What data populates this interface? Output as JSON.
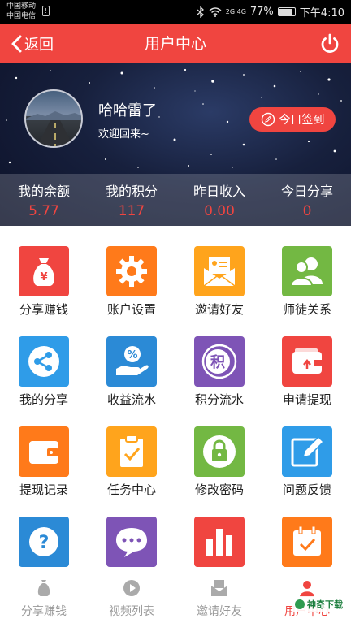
{
  "statusbar": {
    "carrier1": "中国移动",
    "carrier2": "中国电信",
    "signal": "2G 4G",
    "battery": "77%",
    "time": "下午4:10"
  },
  "navbar": {
    "back_label": "返回",
    "title": "用户中心"
  },
  "profile": {
    "username": "哈哈雷了",
    "welcome": "欢迎回来~",
    "checkin_label": "今日签到"
  },
  "stats": [
    {
      "label": "我的余额",
      "value": "5.77"
    },
    {
      "label": "我的积分",
      "value": "117"
    },
    {
      "label": "昨日收入",
      "value": "0.00"
    },
    {
      "label": "今日分享",
      "value": "0"
    }
  ],
  "menu": [
    {
      "label": "分享赚钱",
      "icon": "money-bag-icon",
      "color": "#f04540"
    },
    {
      "label": "账户设置",
      "icon": "gear-icon",
      "color": "#ff7a1a"
    },
    {
      "label": "邀请好友",
      "icon": "envelope-icon",
      "color": "#ffa41c"
    },
    {
      "label": "师徒关系",
      "icon": "users-icon",
      "color": "#73b843"
    },
    {
      "label": "我的分享",
      "icon": "share-icon",
      "color": "#2f9ce8"
    },
    {
      "label": "收益流水",
      "icon": "hand-percent-icon",
      "color": "#2b8ad6"
    },
    {
      "label": "积分流水",
      "icon": "points-icon",
      "color": "#7e54b6"
    },
    {
      "label": "申请提现",
      "icon": "wallet-icon",
      "color": "#f04540"
    },
    {
      "label": "提现记录",
      "icon": "wallet-record-icon",
      "color": "#ff7a1a"
    },
    {
      "label": "任务中心",
      "icon": "clipboard-check-icon",
      "color": "#ffa41c"
    },
    {
      "label": "修改密码",
      "icon": "lock-icon",
      "color": "#73b843"
    },
    {
      "label": "问题反馈",
      "icon": "pencil-icon",
      "color": "#2f9ce8"
    },
    {
      "label": "",
      "icon": "question-icon",
      "color": "#2b8ad6"
    },
    {
      "label": "",
      "icon": "chat-icon",
      "color": "#7e54b6"
    },
    {
      "label": "",
      "icon": "bar-chart-icon",
      "color": "#f04540"
    },
    {
      "label": "",
      "icon": "calendar-check-icon",
      "color": "#ff7a1a"
    }
  ],
  "tabs": [
    {
      "label": "分享赚钱",
      "icon": "money-bag-icon"
    },
    {
      "label": "视频列表",
      "icon": "play-icon"
    },
    {
      "label": "邀请好友",
      "icon": "envelope-icon"
    },
    {
      "label": "用户中心",
      "icon": "user-icon",
      "active": true
    }
  ],
  "watermark": "神奇下载"
}
